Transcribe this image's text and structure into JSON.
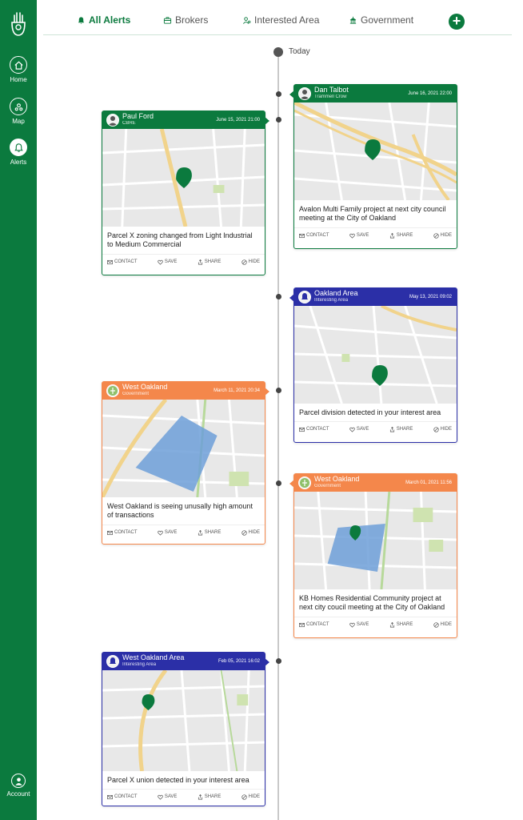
{
  "colors": {
    "brand": "#0b7a3e",
    "broker": "#0b7a3e",
    "interest_area": "#2b2fa7",
    "government": "#f4874b",
    "pin": "#0b7a3e",
    "parcel": "#6d9fd8"
  },
  "sidebar": {
    "items": [
      {
        "label": "Home",
        "icon": "home-icon"
      },
      {
        "label": "Map",
        "icon": "map-icon"
      },
      {
        "label": "Alerts",
        "icon": "bell-icon"
      },
      {
        "label": "Account",
        "icon": "user-icon"
      }
    ]
  },
  "tabs": [
    {
      "label": "All Alerts",
      "icon": "bell-icon"
    },
    {
      "label": "Brokers",
      "icon": "briefcase-icon"
    },
    {
      "label": "Interested Area",
      "icon": "person-pin-icon"
    },
    {
      "label": "Government",
      "icon": "government-icon"
    }
  ],
  "timeline": {
    "today_label": "Today"
  },
  "actions": {
    "contact": "CONTACT",
    "save": "SAVE",
    "share": "SHARE",
    "hide": "HIDE"
  },
  "cards": [
    {
      "name": "Dan Talbot",
      "subtitle": "Trammell Crow",
      "date": "June 16, 2021 22:00",
      "description": "Avalon Multi Family project at next city council meeting at the City of Oakland"
    },
    {
      "name": "Paul Ford",
      "subtitle": "CBRE",
      "date": "June 15, 2021 21:00",
      "description": "Parcel X zoning changed from Light Industrial to Medium Commercial"
    },
    {
      "name": "Oakland Area",
      "subtitle": "Interesting Area",
      "date": "May 13, 2021 09:02",
      "description": "Parcel division detected in your interest area"
    },
    {
      "name": "West Oakland",
      "subtitle": "Government",
      "date": "March 11, 2021 20:34",
      "description": "West Oakland is seeing unusally high amount of transactions"
    },
    {
      "name": "West Oakland",
      "subtitle": "Government",
      "date": "March 01, 2021 11:56",
      "description": "KB Homes Residential  Community project at next city coucil  meeting at the City of Oakland"
    },
    {
      "name": "West Oakland Area",
      "subtitle": "Interesting Area",
      "date": "Feb 05, 2021 16:02",
      "description": "Parcel X union detected in your interest area"
    }
  ]
}
